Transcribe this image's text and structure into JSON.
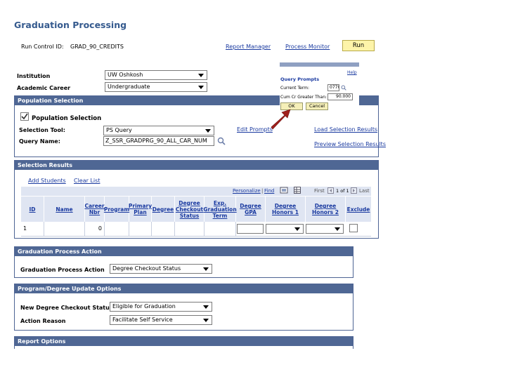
{
  "page": {
    "title": "Graduation Processing"
  },
  "run_control": {
    "label": "Run Control ID:",
    "value": "GRAD_90_CREDITS",
    "report_manager": "Report Manager",
    "process_monitor": "Process Monitor",
    "run": "Run"
  },
  "institution": {
    "label": "Institution",
    "value": "UW Oshkosh"
  },
  "academic_career": {
    "label": "Academic Career",
    "value": "Undergraduate"
  },
  "population_selection": {
    "header": "Population Selection",
    "checkbox_label": "Population Selection",
    "checked": true,
    "selection_tool": {
      "label": "Selection Tool:",
      "value": "PS Query"
    },
    "query_name": {
      "label": "Query Name:",
      "value": "Z_SSR_GRADPRG_90_ALL_CAR_NUM"
    },
    "edit_prompts": "Edit Prompts",
    "load_results": "Load Selection Results",
    "preview_results": "Preview Selection Results"
  },
  "query_prompts": {
    "help": "Help",
    "title": "Query Prompts",
    "field1_label": "Current Term:",
    "field1_value": "0770",
    "field2_label": "Cum Cr Greater Than:",
    "field2_value": "90.000",
    "ok": "OK",
    "cancel": "Cancel"
  },
  "selection_results": {
    "header": "Selection Results",
    "add_students": "Add Students",
    "clear_list": "Clear List",
    "personalize": "Personalize",
    "find": "Find",
    "first": "First",
    "page_info": "1 of 1",
    "last": "Last",
    "columns": [
      "ID",
      "Name",
      "Career Nbr",
      "Program",
      "Primary Plan",
      "Degree",
      "Degree Checkout Status",
      "Exp. Graduation Term",
      "Degree GPA",
      "Degree Honors 1",
      "Degree Honors 2",
      "Exclude"
    ],
    "row": {
      "id": "1",
      "career_nbr": "0"
    }
  },
  "graduation_process_action": {
    "header": "Graduation Process Action",
    "label": "Graduation Process Action",
    "value": "Degree Checkout Status"
  },
  "program_degree_update": {
    "header": "Program/Degree Update Options",
    "status_label": "New Degree Checkout Status",
    "status_value": "Eligible for Graduation",
    "reason_label": "Action Reason",
    "reason_value": "Facilitate Self Service"
  },
  "report_options": {
    "header": "Report Options"
  },
  "colors": {
    "header_bg": "#4f6794",
    "title": "#355a8e",
    "link": "#1a3aa0",
    "run_button": "#fdf4a9",
    "arrow": "#a0201c"
  }
}
